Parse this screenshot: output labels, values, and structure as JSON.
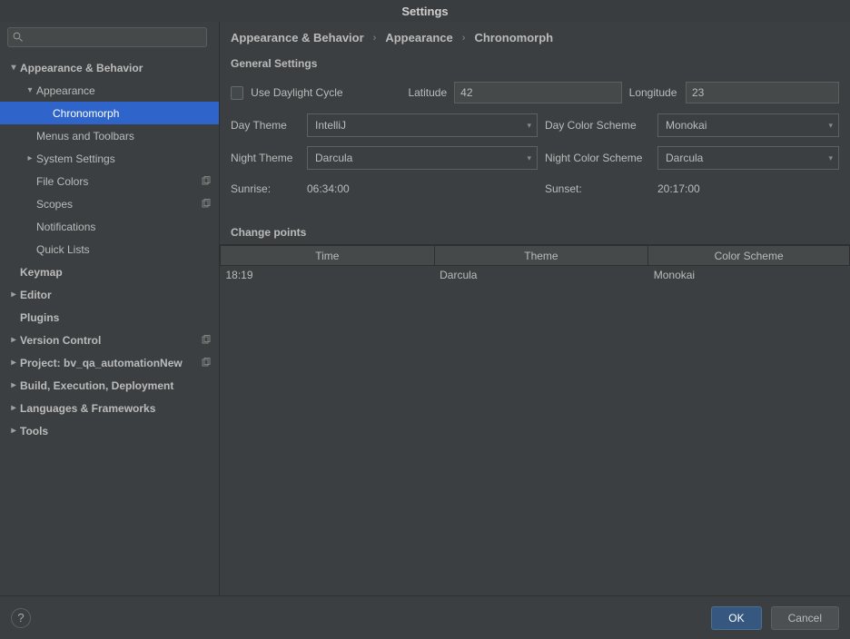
{
  "window": {
    "title": "Settings"
  },
  "search": {
    "placeholder": ""
  },
  "sidebar": {
    "items": [
      {
        "label": "Appearance & Behavior",
        "indent": 0,
        "arrow": "open",
        "bold": true,
        "copy": false
      },
      {
        "label": "Appearance",
        "indent": 1,
        "arrow": "open",
        "bold": false,
        "copy": false
      },
      {
        "label": "Chronomorph",
        "indent": 2,
        "arrow": "none",
        "bold": false,
        "copy": false,
        "selected": true
      },
      {
        "label": "Menus and Toolbars",
        "indent": 1,
        "arrow": "none",
        "bold": false,
        "copy": false
      },
      {
        "label": "System Settings",
        "indent": 1,
        "arrow": "closed",
        "bold": false,
        "copy": false
      },
      {
        "label": "File Colors",
        "indent": 1,
        "arrow": "none",
        "bold": false,
        "copy": true
      },
      {
        "label": "Scopes",
        "indent": 1,
        "arrow": "none",
        "bold": false,
        "copy": true
      },
      {
        "label": "Notifications",
        "indent": 1,
        "arrow": "none",
        "bold": false,
        "copy": false
      },
      {
        "label": "Quick Lists",
        "indent": 1,
        "arrow": "none",
        "bold": false,
        "copy": false
      },
      {
        "label": "Keymap",
        "indent": 0,
        "arrow": "none",
        "bold": true,
        "copy": false
      },
      {
        "label": "Editor",
        "indent": 0,
        "arrow": "closed",
        "bold": true,
        "copy": false
      },
      {
        "label": "Plugins",
        "indent": 0,
        "arrow": "none",
        "bold": true,
        "copy": false
      },
      {
        "label": "Version Control",
        "indent": 0,
        "arrow": "closed",
        "bold": true,
        "copy": true
      },
      {
        "label": "Project: bv_qa_automationNew",
        "indent": 0,
        "arrow": "closed",
        "bold": true,
        "copy": true
      },
      {
        "label": "Build, Execution, Deployment",
        "indent": 0,
        "arrow": "closed",
        "bold": true,
        "copy": false
      },
      {
        "label": "Languages & Frameworks",
        "indent": 0,
        "arrow": "closed",
        "bold": true,
        "copy": false
      },
      {
        "label": "Tools",
        "indent": 0,
        "arrow": "closed",
        "bold": true,
        "copy": false
      }
    ]
  },
  "breadcrumb": {
    "a": "Appearance & Behavior",
    "b": "Appearance",
    "c": "Chronomorph"
  },
  "sections": {
    "general": "General Settings",
    "changepoints": "Change points"
  },
  "form": {
    "use_daylight_cycle": "Use Daylight Cycle",
    "latitude_label": "Latitude",
    "latitude_value": "42",
    "longitude_label": "Longitude",
    "longitude_value": "23",
    "day_theme_label": "Day Theme",
    "day_theme_value": "IntelliJ",
    "day_color_label": "Day Color Scheme",
    "day_color_value": "Monokai",
    "night_theme_label": "Night Theme",
    "night_theme_value": "Darcula",
    "night_color_label": "Night Color Scheme",
    "night_color_value": "Darcula",
    "sunrise_label": "Sunrise:",
    "sunrise_value": "06:34:00",
    "sunset_label": "Sunset:",
    "sunset_value": "20:17:00"
  },
  "table": {
    "columns": [
      "Time",
      "Theme",
      "Color Scheme"
    ],
    "rows": [
      {
        "time": "18:19",
        "theme": "Darcula",
        "scheme": "Monokai"
      }
    ]
  },
  "footer": {
    "ok": "OK",
    "cancel": "Cancel"
  }
}
